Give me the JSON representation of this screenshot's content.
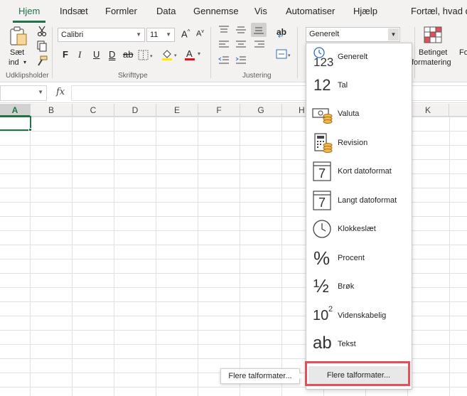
{
  "tabs": [
    {
      "label": "Hjem",
      "active": true
    },
    {
      "label": "Indsæt"
    },
    {
      "label": "Formler"
    },
    {
      "label": "Data"
    },
    {
      "label": "Gennemse"
    },
    {
      "label": "Vis"
    },
    {
      "label": "Automatiser"
    },
    {
      "label": "Hjælp"
    },
    {
      "label": "Fortæl, hvad d"
    }
  ],
  "ribbon": {
    "clipboard": {
      "paste_line1": "Sæt",
      "paste_line2": "ind",
      "group_label": "Udklipsholder"
    },
    "font": {
      "name": "Calibri",
      "size": "11",
      "grow": "A",
      "shrink": "A",
      "bold": "F",
      "italic": "I",
      "underline": "U",
      "double_underline": "D",
      "strike": "ab",
      "font_color_glyph": "A",
      "group_label": "Skrifttype"
    },
    "alignment": {
      "group_label": "Justering",
      "wrap_glyph": "ab"
    },
    "number": {
      "format_value": "Generelt"
    },
    "conditional": {
      "line1": "Betinget",
      "line2": "formatering",
      "partial_next": "Fo"
    }
  },
  "formula_bar": {
    "fx": "fx"
  },
  "columns": [
    "A",
    "B",
    "C",
    "D",
    "E",
    "F",
    "G",
    "H",
    "K"
  ],
  "number_formats": [
    {
      "label": "Generelt",
      "icon": "clock-123-icon",
      "glyph": "123"
    },
    {
      "label": "Tal",
      "icon": "number-12-icon",
      "glyph": "12"
    },
    {
      "label": "Valuta",
      "icon": "currency-icon"
    },
    {
      "label": "Revision",
      "icon": "calculator-coins-icon"
    },
    {
      "label": "Kort datoformat",
      "icon": "calendar-icon",
      "glyph": "7"
    },
    {
      "label": "Langt datoformat",
      "icon": "calendar-icon",
      "glyph": "7"
    },
    {
      "label": "Klokkeslæt",
      "icon": "clock-icon"
    },
    {
      "label": "Procent",
      "icon": "percent-icon",
      "glyph": "%"
    },
    {
      "label": "Brøk",
      "icon": "fraction-icon",
      "glyph": "½"
    },
    {
      "label": "Videnskabelig",
      "icon": "scientific-icon",
      "glyph": "10",
      "sup": "2"
    },
    {
      "label": "Tekst",
      "icon": "text-ab-icon",
      "glyph": "ab"
    }
  ],
  "more_formats": "Flere talformater...",
  "tooltip": "Flere talformater...",
  "colors": {
    "accent": "#217346",
    "highlight": "#e2505a",
    "font_color_bar": "#e81123",
    "fill_bar": "#ffeb00"
  }
}
